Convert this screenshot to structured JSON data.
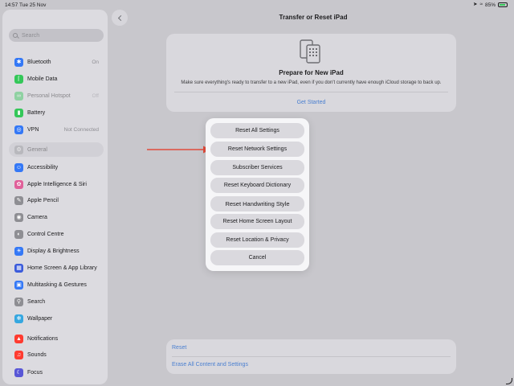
{
  "statusbar": {
    "time": "14:57",
    "date": "Tue 25 Nov",
    "battery": "85%",
    "icons": [
      "location-icon",
      "wifi-icon",
      "battery-icon"
    ]
  },
  "sidebar": {
    "search_placeholder": "Search",
    "items": [
      {
        "label": "Bluetooth",
        "value": "On",
        "icon": "bluetooth-icon",
        "color": "#3478f6"
      },
      {
        "label": "Mobile Data",
        "value": "",
        "icon": "antenna-icon",
        "color": "#34c759"
      },
      {
        "label": "Personal Hotspot",
        "value": "Off",
        "icon": "hotspot-icon",
        "color": "#34c759"
      },
      {
        "label": "Battery",
        "value": "",
        "icon": "battery-icon",
        "color": "#34c759"
      },
      {
        "label": "VPN",
        "value": "Not Connected",
        "icon": "globe-icon",
        "color": "#3478f6"
      },
      {
        "label": "General",
        "value": "",
        "icon": "gear-icon",
        "color": "#8e8e93"
      },
      {
        "label": "Accessibility",
        "value": "",
        "icon": "accessibility-icon",
        "color": "#3478f6"
      },
      {
        "label": "Apple Intelligence & Siri",
        "value": "",
        "icon": "siri-icon",
        "color": "#e0609a"
      },
      {
        "label": "Apple Pencil",
        "value": "",
        "icon": "pencil-icon",
        "color": "#8e8e93"
      },
      {
        "label": "Camera",
        "value": "",
        "icon": "camera-icon",
        "color": "#8e8e93"
      },
      {
        "label": "Control Centre",
        "value": "",
        "icon": "toggles-icon",
        "color": "#8e8e93"
      },
      {
        "label": "Display & Brightness",
        "value": "",
        "icon": "sun-icon",
        "color": "#3478f6"
      },
      {
        "label": "Home Screen & App Library",
        "value": "",
        "icon": "grid-icon",
        "color": "#3b5bdb"
      },
      {
        "label": "Multitasking & Gestures",
        "value": "",
        "icon": "windows-icon",
        "color": "#3478f6"
      },
      {
        "label": "Search",
        "value": "",
        "icon": "search-icon",
        "color": "#8e8e93"
      },
      {
        "label": "Wallpaper",
        "value": "",
        "icon": "flower-icon",
        "color": "#35a7e0"
      },
      {
        "label": "Notifications",
        "value": "",
        "icon": "bell-icon",
        "color": "#ff3b30"
      },
      {
        "label": "Sounds",
        "value": "",
        "icon": "speaker-icon",
        "color": "#ff3b30"
      },
      {
        "label": "Focus",
        "value": "",
        "icon": "moon-icon",
        "color": "#5856d6"
      }
    ]
  },
  "header": {
    "title": "Transfer or Reset iPad"
  },
  "prepare": {
    "title": "Prepare for New iPad",
    "description": "Make sure everything's ready to transfer to a new iPad, even if you don't currently have enough iCloud storage to back up.",
    "action": "Get Started"
  },
  "menu": {
    "items": [
      "Reset All Settings",
      "Reset Network Settings",
      "Subscriber Services",
      "Reset Keyboard Dictionary",
      "Reset Handwriting Style",
      "Reset Home Screen Layout",
      "Reset Location & Privacy",
      "Cancel"
    ]
  },
  "reset_section": {
    "reset": "Reset",
    "erase": "Erase All Content and Settings"
  },
  "colors": {
    "accent": "#4a7fd0",
    "arrow": "#e04b3c"
  }
}
